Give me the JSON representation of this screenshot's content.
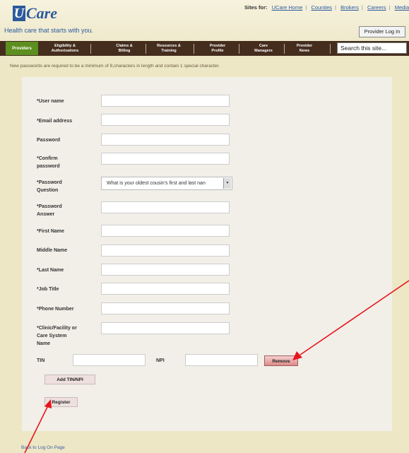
{
  "logo": {
    "mark": "U",
    "rest": "Care"
  },
  "header": {
    "tagline": "Health care that starts with you.",
    "sites_label": "Sites for:",
    "sites": [
      "UCare Home",
      "Counties",
      "Brokers",
      "Careers",
      "Media"
    ],
    "login_button": "Provider Log In"
  },
  "nav": {
    "providers": "Providers",
    "items": [
      {
        "l1": "Eligibility &",
        "l2": "Authorizations"
      },
      {
        "l1": "Claims &",
        "l2": "Billing"
      },
      {
        "l1": "Resources &",
        "l2": "Training"
      },
      {
        "l1": "Provider",
        "l2": "Profile"
      },
      {
        "l1": "Care",
        "l2": "Managers"
      },
      {
        "l1": "Provider",
        "l2": "News"
      }
    ],
    "search_placeholder": "Search this site..."
  },
  "note": "New passwords are required to be a minimum of 8,characters in length and contain 1 special character.",
  "form": {
    "user_name": "*User name",
    "email": "*Email address",
    "password": "Password",
    "confirm_l1": "*Confirm",
    "confirm_l2": "password",
    "question_l1": "*Password",
    "question_l2": "Question",
    "question_value": "What is your oldest cousin's first and last nan",
    "answer_l1": "*Password",
    "answer_l2": "Answer",
    "first_name": "*First Name",
    "middle_name": "Middle Name",
    "last_name": "*Last Name",
    "job_title": "*Job Title",
    "phone": "*Phone Number",
    "clinic_l1": "*Clinic/Facility or",
    "clinic_l2": "Care System",
    "clinic_l3": "Name",
    "tin": "TIN",
    "npi": "NPI",
    "remove": "Remove",
    "add_tin": "Add TIN/NPI",
    "register": "Register"
  },
  "back_link": "Back to Log On Page",
  "colors": {
    "background": "#ede7c6",
    "nav_bar": "#452d1e",
    "providers_tab": "#5c8f1f",
    "brand_blue": "#2c5a9c",
    "annotation_arrow": "#e8141c"
  }
}
